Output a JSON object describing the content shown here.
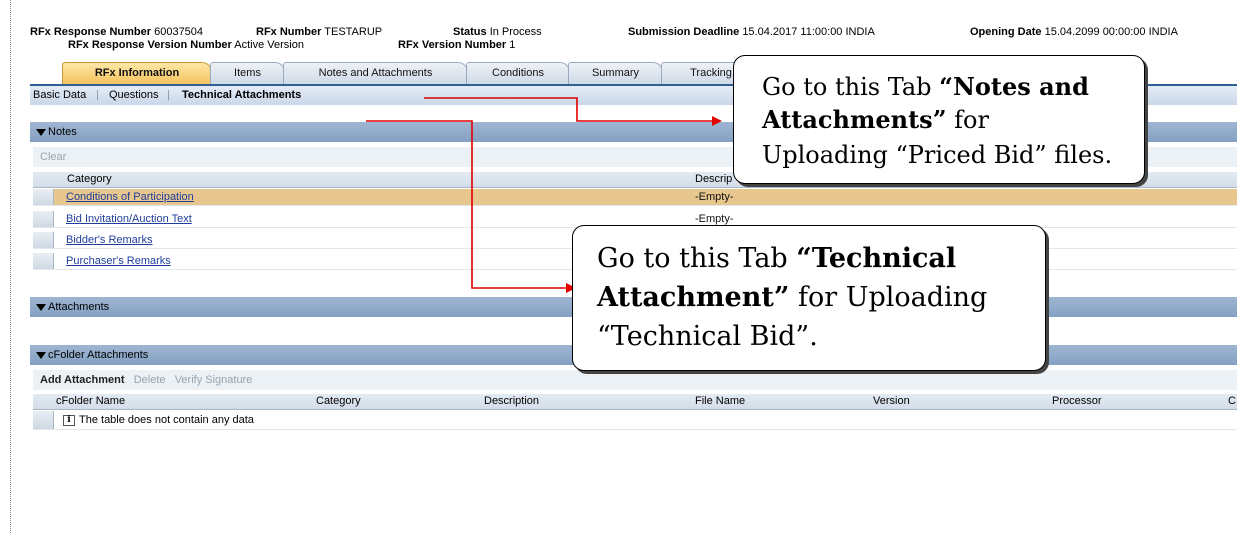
{
  "header": {
    "response_number_label": "RFx Response Number",
    "response_number_value": "60037504",
    "rfx_number_label": "RFx Number",
    "rfx_number_value": "TESTARUP",
    "status_label": "Status",
    "status_value": "In Process",
    "deadline_label": "Submission Deadline",
    "deadline_value": "15.04.2017 11:00:00 INDIA",
    "opening_label": "Opening Date",
    "opening_value": "15.04.2099 00:00:00 INDIA",
    "response_version_label": "RFx Response Version Number",
    "response_version_value": "Active Version",
    "rfx_version_label": "RFx Version Number",
    "rfx_version_value": "1"
  },
  "tabs": [
    "RFx Information",
    "Items",
    "Notes and Attachments",
    "Conditions",
    "Summary",
    "Tracking"
  ],
  "active_tab": "RFx Information",
  "subtabs": [
    "Basic Data",
    "Questions",
    "Technical Attachments"
  ],
  "notes": {
    "title": "Notes",
    "toolbar_clear": "Clear",
    "col_category": "Category",
    "col_description": "Descrip",
    "rows": [
      {
        "category": "Conditions of Participation",
        "description": "-Empty-"
      },
      {
        "category": "Bid Invitation/Auction Text",
        "description": "-Empty-"
      },
      {
        "category": "Bidder's Remarks",
        "description": ""
      },
      {
        "category": "Purchaser's Remarks",
        "description": ""
      }
    ]
  },
  "attachments": {
    "title": "Attachments"
  },
  "cfolder": {
    "title": "cFolder Attachments",
    "toolbar": {
      "add": "Add Attachment",
      "delete": "Delete",
      "verify": "Verify Signature"
    },
    "columns": [
      "cFolder Name",
      "Category",
      "Description",
      "File Name",
      "Version",
      "Processor",
      "C"
    ],
    "empty_icon": "i",
    "empty_text": "The table does not contain any data"
  },
  "callouts": {
    "notes_tab": {
      "line1_plain": "Go to this Tab ",
      "line1_bold": "“Notes and",
      "line2_bold": "Attachments”",
      "line2_plain": " for",
      "line3": "Uploading “Priced Bid” files."
    },
    "technical_tab": {
      "line1_plain": "Go to this Tab ",
      "line1_bold": "“Technical",
      "line2_bold": "Attachment”",
      "line2_plain": " for Uploading",
      "line3": "“Technical Bid”."
    }
  },
  "colors": {
    "arrow": "#e00000",
    "selected_row": "#e8c78f",
    "section_header": "#8ea8c8",
    "active_tab": "#f4c35e"
  }
}
